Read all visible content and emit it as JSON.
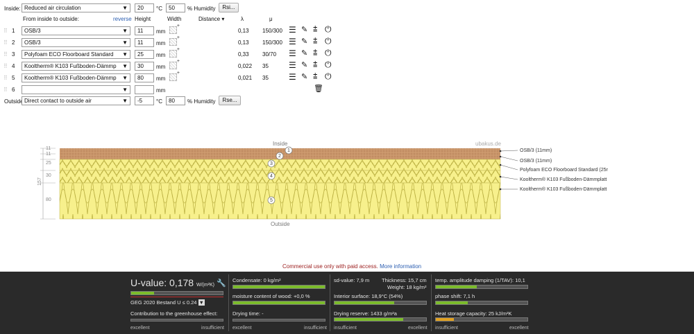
{
  "inside": {
    "label": "Inside:",
    "condition": "Reduced air circulation",
    "temp": "20",
    "temp_unit": "°C",
    "humidity": "50",
    "humidity_unit": "% Humidity",
    "rsi_button": "Rsi..."
  },
  "columns": {
    "from": "From inside to outside:",
    "reverse": "reverse",
    "height": "Height",
    "width": "Width",
    "distance": "Distance",
    "lambda": "λ",
    "mu": "μ"
  },
  "layers": [
    {
      "num": "1",
      "material": "OSB/3",
      "height": "11",
      "unit": "mm",
      "lambda": "0,13",
      "mu": "150/300"
    },
    {
      "num": "2",
      "material": "OSB/3",
      "height": "11",
      "unit": "mm",
      "lambda": "0,13",
      "mu": "150/300"
    },
    {
      "num": "3",
      "material": "Polyfoam ECO Floorboard Standard",
      "height": "25",
      "unit": "mm",
      "lambda": "0,33",
      "mu": "30/70"
    },
    {
      "num": "4",
      "material": "Kooltherm® K103 Fußboden-Dämmp",
      "height": "30",
      "unit": "mm",
      "lambda": "0,022",
      "mu": "35"
    },
    {
      "num": "5",
      "material": "Kooltherm® K103 Fußboden-Dämmp",
      "height": "80",
      "unit": "mm",
      "lambda": "0,021",
      "mu": "35"
    },
    {
      "num": "6",
      "material": "",
      "height": "",
      "unit": "mm",
      "lambda": "",
      "mu": ""
    }
  ],
  "outside": {
    "label": "Outside",
    "condition": "Direct contact to outside air",
    "temp": "-5",
    "temp_unit": "°C",
    "humidity": "80",
    "humidity_unit": "% Humidity",
    "rse_button": "Rse..."
  },
  "diagram": {
    "inside_label": "Inside",
    "outside_label": "Outside",
    "watermark": "ubakus.de",
    "total_thickness": "157",
    "dim_labels": [
      "11",
      "11",
      "25",
      "30",
      "80"
    ],
    "layer_labels": [
      "OSB/3 (11mm)",
      "OSB/3 (11mm)",
      "Polyfoam ECO Floorboard Standard (25r",
      "Kooltherm® K103 Fußboden-Dämmplatt",
      "Kooltherm® K103 Fußboden-Dämmplatt"
    ],
    "markers": [
      "1",
      "2",
      "3",
      "4",
      "5"
    ]
  },
  "notice": {
    "text": "Commercial use only with paid access.",
    "link": "More information"
  },
  "footer": {
    "uvalue_label": "U-value:",
    "uvalue": "0,178",
    "uvalue_unit": "W/(m²K)",
    "geg": "GEG 2020 Bestand U ≤ 0.24",
    "greenhouse": "Contribution to the greenhouse effect:",
    "excellent": "excellent",
    "insufficient": "insufficient",
    "condensate": "Condensate: 0 kg/m²",
    "moisture": "moisture content of wood: +0,0 %",
    "drying_time": "Drying time: -",
    "sd_value": "sd-value: 7,9 m",
    "thickness": "Thickness: 15,7 cm",
    "weight": "Weight: 18 kg/m²",
    "interior_surface": "Interior surface: 18,9°C (54%)",
    "drying_reserve": "Drying reserve: 1433 g/m²a",
    "temp_amp": "temp. amplitude damping (1/TAV): 10,1",
    "phase_shift": "phase shift: 7,1 h",
    "heat_storage": "Heat storage capacity: 25 kJ/m²K",
    "uvalue_rating": 0.25,
    "condensate_rating": 1.0,
    "moisture_rating": 1.0,
    "interior_rating": 0.65,
    "drying_rating": 0.75,
    "temp_amp_rating": 0.45,
    "phase_rating": 0.35,
    "heat_rating": 0.2
  },
  "colors": {
    "osb": "#c9956a",
    "insulation": "#f7f08c",
    "accent_green": "#7cbc2b",
    "link_blue": "#2a5db0",
    "notice_red": "#9b1c1c"
  }
}
